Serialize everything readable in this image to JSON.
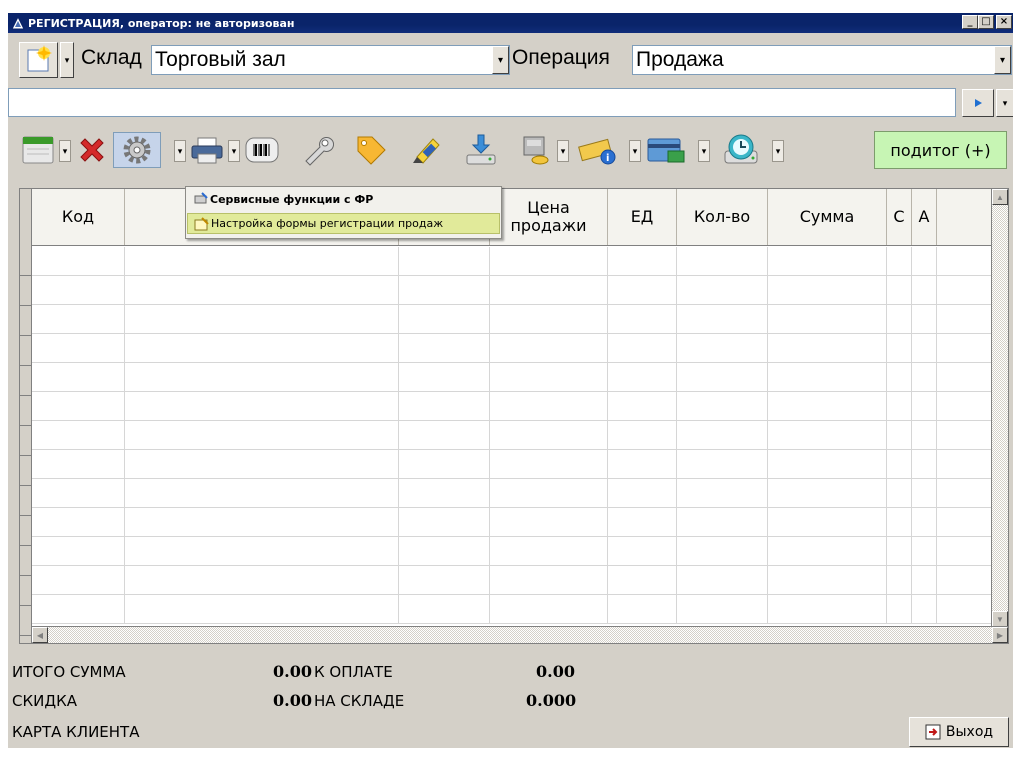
{
  "window": {
    "title": "РЕГИСТРАЦИЯ, оператор: не авторизован",
    "controls": [
      "_",
      "□",
      "×"
    ]
  },
  "row1": {
    "warehouse_label": "Склад",
    "warehouse_value": "Торговый зал",
    "operation_label": "Операция",
    "operation_value": "Продажа"
  },
  "search": {
    "value": ""
  },
  "toolbar": {
    "subtotal_label": "подитог (+)",
    "icons": [
      "calendar-icon",
      "delete-icon",
      "settings-gear-icon",
      "printer-icon",
      "barcode-icon",
      "wrench-icon",
      "tag-icon",
      "art-label-icon",
      "download-device-icon",
      "cash-drawer-icon",
      "info-card-icon",
      "payment-card-icon",
      "clock-icon"
    ]
  },
  "menu": {
    "items": [
      {
        "label": "Сервисные функции с ФР",
        "icon": "service-icon"
      },
      {
        "label": "Настройка формы регистрации продаж",
        "icon": "form-settings-icon"
      }
    ]
  },
  "grid": {
    "columns": [
      {
        "label": "Код"
      },
      {
        "label": ""
      },
      {
        "label": ""
      },
      {
        "label": "Цена продажи"
      },
      {
        "label": "ЕД"
      },
      {
        "label": "Кол-во"
      },
      {
        "label": "Сумма"
      },
      {
        "label": "С"
      },
      {
        "label": "А"
      },
      {
        "label": ""
      }
    ],
    "row_count": 13
  },
  "totals": {
    "total_sum_label": "ИТОГО СУММА",
    "total_sum_value": "0.00",
    "to_pay_label": "К ОПЛАТЕ",
    "to_pay_value": "0.00",
    "discount_label": "СКИДКА",
    "discount_value": "0.00",
    "in_stock_label": "НА СКЛАДЕ",
    "in_stock_value": "0.000",
    "client_card_label": "КАРТА КЛИЕНТА"
  },
  "exit_label": "Выход"
}
